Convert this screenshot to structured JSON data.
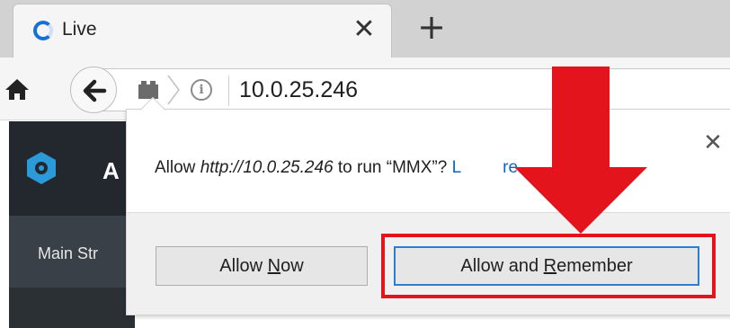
{
  "browser": {
    "tab": {
      "title": "Live",
      "close_glyph": "✕"
    },
    "new_tab_glyph": "+",
    "nav": {
      "url": "10.0.25.246",
      "info_glyph": "i"
    }
  },
  "page": {
    "app_title_fragment": "A",
    "subnav_label": "Main Str"
  },
  "popup": {
    "message": {
      "prefix": "Allow ",
      "url": "http://10.0.25.246",
      "middle": " to run “MMX”? ",
      "link_visible": "L",
      "link_tail": "re..."
    },
    "close_glyph": "✕",
    "buttons": {
      "allow_now": {
        "pre": "Allow ",
        "underlined": "N",
        "post": "ow"
      },
      "allow_remember": {
        "pre": "Allow and ",
        "underlined": "R",
        "post": "emember"
      }
    }
  },
  "annotations": {
    "highlight_color": "#e3141b",
    "arrow_color": "#e3141b"
  },
  "icons": [
    "favicon-icon",
    "close-icon",
    "plus-icon",
    "home-icon",
    "back-arrow-icon",
    "plugin-icon",
    "info-icon",
    "app-logo-icon"
  ]
}
